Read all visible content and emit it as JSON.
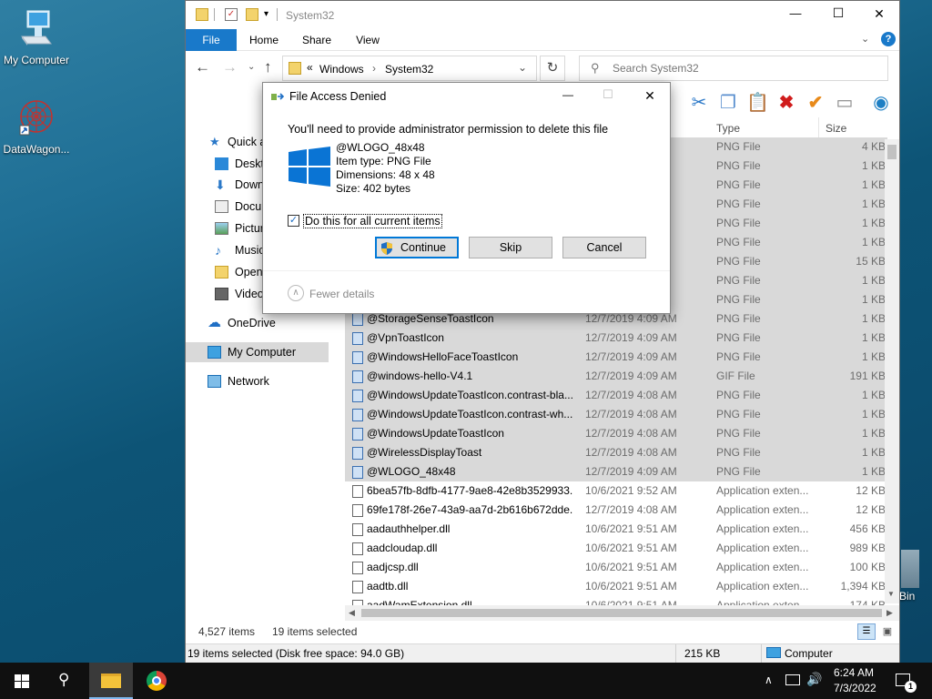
{
  "desktop": {
    "icons": [
      {
        "label": "My Computer"
      },
      {
        "label": "DataWagon..."
      },
      {
        "label": "Bin"
      }
    ]
  },
  "explorer": {
    "title": "System32",
    "window_controls": {
      "minimize": "—",
      "maximize": "☐",
      "close": "✕"
    },
    "ribbon": {
      "tabs": [
        "File",
        "Home",
        "Share",
        "View"
      ],
      "help": "?"
    },
    "address": {
      "path_root": "Windows",
      "path_leaf": "System32",
      "separator": "«",
      "chev": "›"
    },
    "search": {
      "placeholder": "Search System32"
    },
    "nav_items": [
      "Quick a",
      "Deskto",
      "Down",
      "Docur",
      "Pictur",
      "Music",
      "Open-",
      "Video",
      "OneDrive",
      "My Computer",
      "Network"
    ],
    "columns": {
      "type": "Type",
      "size": "Size"
    },
    "hidden_rows": [
      {
        "type": "PNG File",
        "size": "4 KB"
      },
      {
        "type": "PNG File",
        "size": "1 KB"
      },
      {
        "type": "PNG File",
        "size": "1 KB"
      },
      {
        "type": "PNG File",
        "size": "1 KB"
      },
      {
        "type": "PNG File",
        "size": "1 KB"
      },
      {
        "type": "PNG File",
        "size": "1 KB"
      },
      {
        "type": "PNG File",
        "size": "15 KB"
      },
      {
        "type": "PNG File",
        "size": "1 KB"
      },
      {
        "type": "PNG File",
        "size": "1 KB"
      },
      {
        "type": "PNG File",
        "size": "1 KB"
      }
    ],
    "rows": [
      {
        "name": "@StorageSenseToastIcon",
        "date": "12/7/2019 4:09 AM",
        "type": "PNG File",
        "size": "1 KB",
        "selected": true
      },
      {
        "name": "@VpnToastIcon",
        "date": "12/7/2019 4:09 AM",
        "type": "PNG File",
        "size": "1 KB",
        "selected": true
      },
      {
        "name": "@WindowsHelloFaceToastIcon",
        "date": "12/7/2019 4:09 AM",
        "type": "PNG File",
        "size": "1 KB",
        "selected": true
      },
      {
        "name": "@windows-hello-V4.1",
        "date": "12/7/2019 4:09 AM",
        "type": "GIF File",
        "size": "191 KB",
        "selected": true
      },
      {
        "name": "@WindowsUpdateToastIcon.contrast-bla...",
        "date": "12/7/2019 4:08 AM",
        "type": "PNG File",
        "size": "1 KB",
        "selected": true
      },
      {
        "name": "@WindowsUpdateToastIcon.contrast-wh...",
        "date": "12/7/2019 4:08 AM",
        "type": "PNG File",
        "size": "1 KB",
        "selected": true
      },
      {
        "name": "@WindowsUpdateToastIcon",
        "date": "12/7/2019 4:08 AM",
        "type": "PNG File",
        "size": "1 KB",
        "selected": true
      },
      {
        "name": "@WirelessDisplayToast",
        "date": "12/7/2019 4:08 AM",
        "type": "PNG File",
        "size": "1 KB",
        "selected": true
      },
      {
        "name": "@WLOGO_48x48",
        "date": "12/7/2019 4:09 AM",
        "type": "PNG File",
        "size": "1 KB",
        "selected": true
      },
      {
        "name": "6bea57fb-8dfb-4177-9ae8-42e8b3529933...",
        "date": "10/6/2021 9:52 AM",
        "type": "Application exten...",
        "size": "12 KB",
        "selected": false
      },
      {
        "name": "69fe178f-26e7-43a9-aa7d-2b616b672dde...",
        "date": "12/7/2019 4:08 AM",
        "type": "Application exten...",
        "size": "12 KB",
        "selected": false
      },
      {
        "name": "aadauthhelper.dll",
        "date": "10/6/2021 9:51 AM",
        "type": "Application exten...",
        "size": "456 KB",
        "selected": false
      },
      {
        "name": "aadcloudap.dll",
        "date": "10/6/2021 9:51 AM",
        "type": "Application exten...",
        "size": "989 KB",
        "selected": false
      },
      {
        "name": "aadjcsp.dll",
        "date": "10/6/2021 9:51 AM",
        "type": "Application exten...",
        "size": "100 KB",
        "selected": false
      },
      {
        "name": "aadtb.dll",
        "date": "10/6/2021 9:51 AM",
        "type": "Application exten...",
        "size": "1,394 KB",
        "selected": false
      },
      {
        "name": "aadWamExtension.dll",
        "date": "10/6/2021 9:51 AM",
        "type": "Application exten...",
        "size": "174 KB",
        "selected": false
      }
    ],
    "status": {
      "count": "4,527 items",
      "selected": "19 items selected"
    },
    "info": {
      "left": "19 items selected (Disk free space: 94.0 GB)",
      "size": "215 KB",
      "location": "Computer"
    }
  },
  "dialog": {
    "title": "File Access Denied",
    "message": "You'll need to provide administrator permission to delete this file",
    "file_name": "@WLOGO_48x48",
    "item_type": "Item type: PNG File",
    "dimensions": "Dimensions: 48 x 48",
    "size": "Size: 402 bytes",
    "checkbox_label": "Do this for all current items",
    "checkbox_checked": true,
    "buttons": {
      "continue": "Continue",
      "skip": "Skip",
      "cancel": "Cancel"
    },
    "fewer_details": "Fewer details",
    "close": "✕",
    "minimize": "—",
    "maximize": "☐"
  },
  "taskbar": {
    "time": "6:24 AM",
    "date": "7/3/2022",
    "notification_count": "1",
    "tray_chev": "∧",
    "start_icon": "windows-start-icon"
  },
  "colors": {
    "accent": "#0078d7",
    "selection": "#d9d9d9",
    "ribbon_file": "#1979ca",
    "taskbar": "#101010"
  }
}
